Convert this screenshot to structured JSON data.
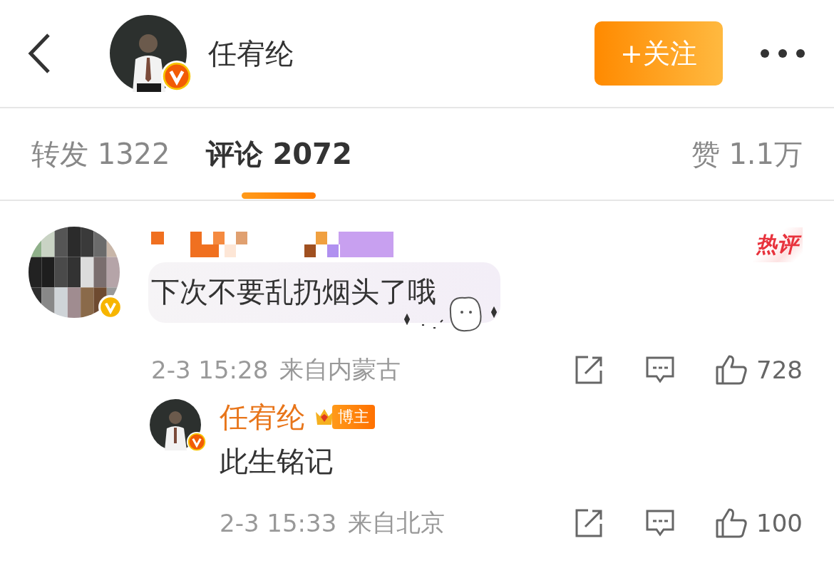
{
  "header": {
    "name": "任宥纶",
    "verified": true,
    "follow_button": "+关注"
  },
  "tabs": [
    {
      "label": "转发 1322",
      "selected": false
    },
    {
      "label": "评论 2072",
      "selected": true
    },
    {
      "label": "赞 1.1万",
      "selected": false
    }
  ],
  "comments": [
    {
      "kind": "comment",
      "verified": true,
      "hot_label": "热评",
      "text": "下次不要乱扔烟头了哦",
      "time": "2-3 15:28",
      "location": "来自内蒙古",
      "likes": "728"
    },
    {
      "kind": "reply",
      "verified": true,
      "name": "任宥纶",
      "author_badge": "博主",
      "text": "此生铭记",
      "time": "2-3 15:33",
      "location": "来自北京",
      "likes": "100"
    }
  ]
}
